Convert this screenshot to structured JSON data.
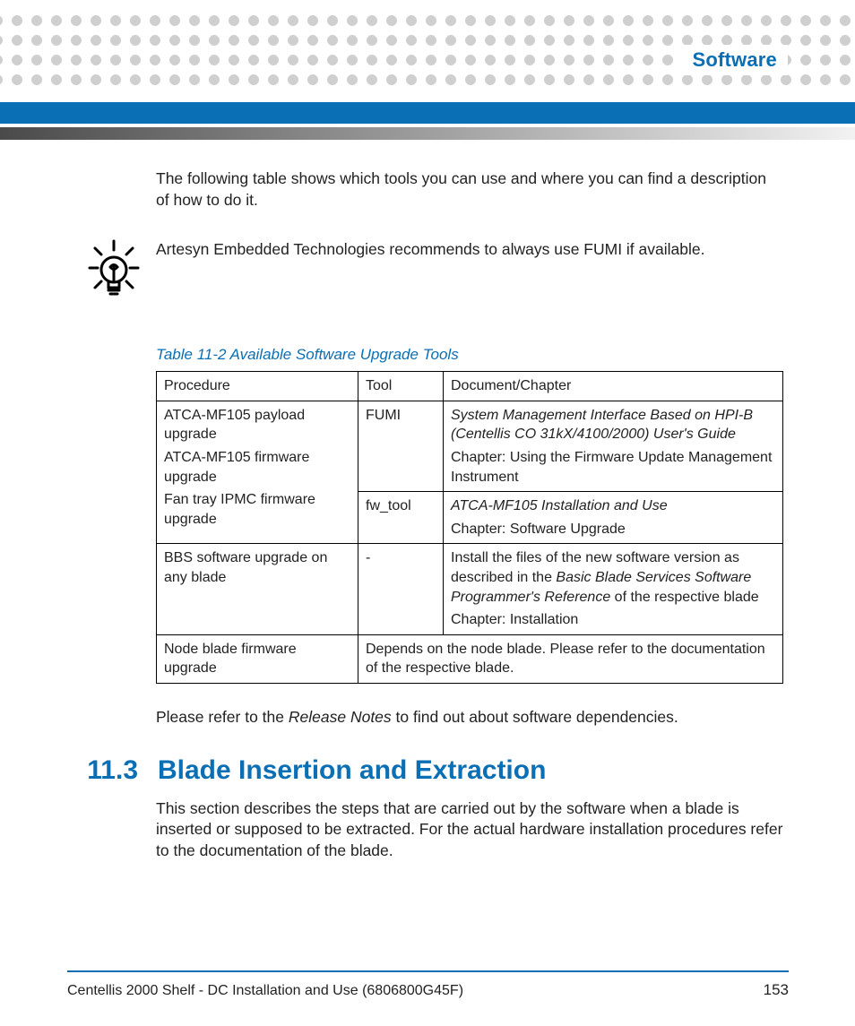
{
  "header": {
    "chapter_title": "Software"
  },
  "intro_para": "The following table shows which tools you can use and where you can find a description of how to do it.",
  "tip_text": "Artesyn Embedded Technologies recommends to always use FUMI if available.",
  "table": {
    "caption": "Table 11-2 Available Software Upgrade Tools",
    "headers": {
      "procedure": "Procedure",
      "tool": "Tool",
      "doc": "Document/Chapter"
    },
    "rows": {
      "r1": {
        "procedure_lines": {
          "l1": "ATCA-MF105 payload upgrade",
          "l2": "ATCA-MF105 firmware upgrade",
          "l3": "Fan tray IPMC firmware upgrade"
        },
        "tool": "FUMI",
        "doc_italic": "System Management Interface Based on HPI-B (Centellis CO 31kX/4100/2000) User's Guide",
        "doc_plain": "Chapter: Using the Firmware Update Management Instrument"
      },
      "r2": {
        "tool": "fw_tool",
        "doc_italic": "ATCA-MF105 Installation and Use",
        "doc_plain": "Chapter: Software Upgrade"
      },
      "r3": {
        "procedure": "BBS software upgrade on any blade",
        "tool": "-",
        "doc_pre": "Install the files of the new software version as described in the ",
        "doc_italic": "Basic Blade Services Software Programmer's Reference",
        "doc_post": " of the respective blade",
        "doc_line2": "Chapter: Installation"
      },
      "r4": {
        "procedure": "Node blade firmware upgrade",
        "merged": "Depends on the node blade. Please refer to the documentation of the respective blade."
      }
    }
  },
  "post_table_pre": "Please refer to the ",
  "post_table_italic": "Release Notes",
  "post_table_post": " to find out about software dependencies.",
  "section": {
    "number": "11.3",
    "title": "Blade Insertion and Extraction",
    "body": "This section describes the steps that are carried out by the software when a blade is inserted or supposed to be extracted. For the actual hardware installation procedures refer to the documentation of the blade."
  },
  "footer": {
    "doc_title": "Centellis 2000 Shelf - DC Installation and Use (6806800G45F)",
    "page_number": "153"
  }
}
